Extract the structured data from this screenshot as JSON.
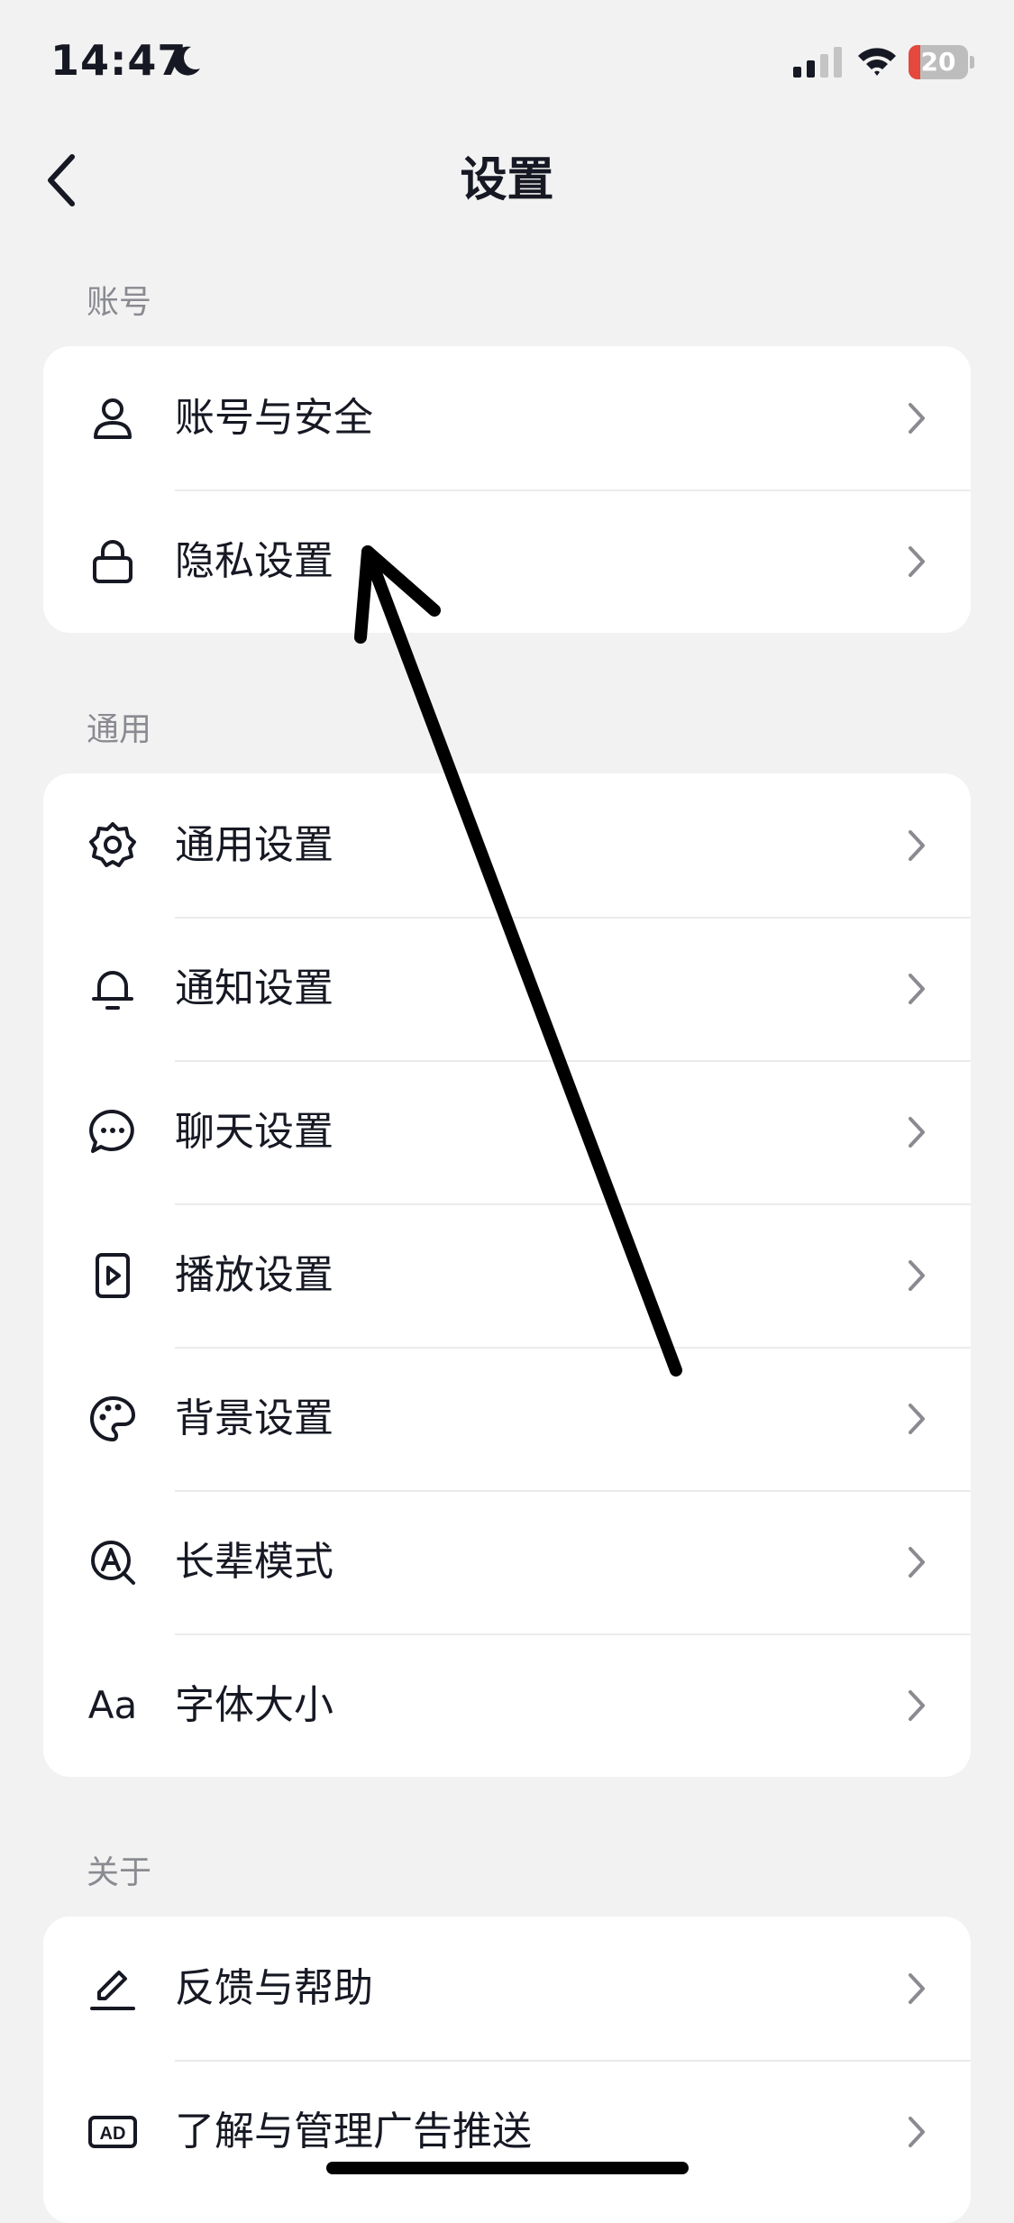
{
  "status_bar": {
    "time": "14:47",
    "battery": "20",
    "battery_level": 0.2
  },
  "nav": {
    "title": "设置"
  },
  "sections": [
    {
      "label": "账号",
      "items": [
        {
          "label": "账号与安全",
          "icon": "person-icon"
        },
        {
          "label": "隐私设置",
          "icon": "lock-icon"
        }
      ]
    },
    {
      "label": "通用",
      "items": [
        {
          "label": "通用设置",
          "icon": "gear-icon"
        },
        {
          "label": "通知设置",
          "icon": "bell-icon"
        },
        {
          "label": "聊天设置",
          "icon": "chat-bubble-icon"
        },
        {
          "label": "播放设置",
          "icon": "play-icon"
        },
        {
          "label": "背景设置",
          "icon": "palette-icon"
        },
        {
          "label": "长辈模式",
          "icon": "elder-mode-icon"
        },
        {
          "label": "字体大小",
          "icon": "font-size-icon",
          "icon_text": "Aa"
        }
      ]
    },
    {
      "label": "关于",
      "items": [
        {
          "label": "反馈与帮助",
          "icon": "pencil-icon"
        },
        {
          "label": "了解与管理广告推送",
          "icon": "ad-icon",
          "icon_text": "AD"
        }
      ]
    }
  ],
  "colors": {
    "background": "#f2f2f2",
    "card": "#ffffff",
    "text": "#161823",
    "secondary": "#8a8b91",
    "annotation": "#000000"
  }
}
